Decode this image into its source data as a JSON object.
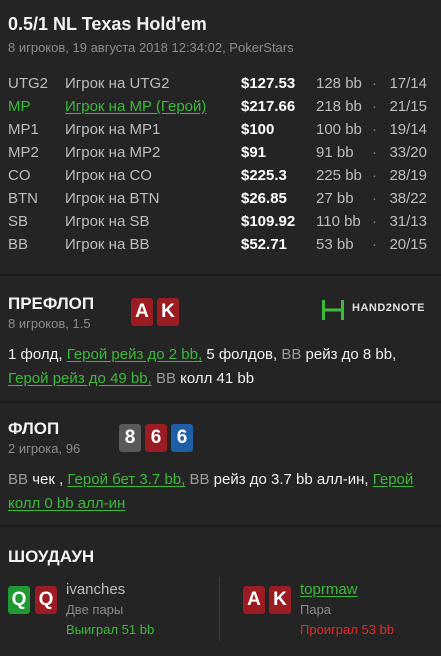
{
  "header": {
    "title": "0.5/1 NL Texas Hold'em",
    "subtitle": "8 игроков, 19 августа 2018 12:34:02, PokerStars"
  },
  "players": [
    {
      "pos": "UTG2",
      "name": "Игрок на UTG2",
      "stack": "$127.53",
      "bb": "128 bb",
      "dot": "·",
      "ratio": "17/14"
    },
    {
      "pos": "MP",
      "name": "Игрок на MP (Герой)",
      "stack": "$217.66",
      "bb": "218 bb",
      "dot": "·",
      "ratio": "21/15"
    },
    {
      "pos": "MP1",
      "name": "Игрок на MP1",
      "stack": "$100",
      "bb": "100 bb",
      "dot": "·",
      "ratio": "19/14"
    },
    {
      "pos": "MP2",
      "name": "Игрок на MP2",
      "stack": "$91",
      "bb": "91 bb",
      "dot": "·",
      "ratio": "33/20"
    },
    {
      "pos": "CO",
      "name": "Игрок на CO",
      "stack": "$225.3",
      "bb": "225 bb",
      "dot": "·",
      "ratio": "28/19"
    },
    {
      "pos": "BTN",
      "name": "Игрок на BTN",
      "stack": "$26.85",
      "bb": "27 bb",
      "dot": "·",
      "ratio": "38/22"
    },
    {
      "pos": "SB",
      "name": "Игрок на SB",
      "stack": "$109.92",
      "bb": "110 bb",
      "dot": "·",
      "ratio": "31/13"
    },
    {
      "pos": "BB",
      "name": "Игрок на BB",
      "stack": "$52.71",
      "bb": "53 bb",
      "dot": "·",
      "ratio": "20/15"
    }
  ],
  "preflop": {
    "title": "ПРЕФЛОП",
    "sub": "8 игроков, 1.5",
    "cards": [
      {
        "rank": "A",
        "color": "#9b1c22"
      },
      {
        "rank": "K",
        "color": "#9b1c22"
      }
    ],
    "logo_text": "HAND2NOTE",
    "logo_icon": "hand2note-logo-icon",
    "actions": {
      "a1": "1 фолд,",
      "a2": "Герой рейз до 2 bb,",
      "a3": "5 фолдов,",
      "a4": "BB",
      "a5": "рейз до 8 bb,",
      "a6": "Герой рейз до 49 bb,",
      "a7": "BB",
      "a8": "колл 41 bb"
    }
  },
  "flop": {
    "title": "ФЛОП",
    "sub": "2 игрока, 96",
    "cards": [
      {
        "rank": "8",
        "color": "#5a5a5a"
      },
      {
        "rank": "6",
        "color": "#9b1c22"
      },
      {
        "rank": "6",
        "color": "#1f5fa8"
      }
    ],
    "actions": {
      "a1": "BB",
      "a2": "чек ,",
      "a3": "Герой бет 3.7 bb,",
      "a4": "BB",
      "a5": "рейз до 3.7 bb алл-ин,",
      "a6": "Герой колл 0 bb алл-ин"
    }
  },
  "showdown": {
    "title": "ШОУДАУН",
    "left": {
      "cards": [
        {
          "rank": "Q",
          "color": "#1f9a33"
        },
        {
          "rank": "Q",
          "color": "#9b1c22"
        }
      ],
      "name": "ivanches",
      "hand": "Две пары",
      "result": "Выиграл 51 bb"
    },
    "right": {
      "cards": [
        {
          "rank": "A",
          "color": "#9b1c22"
        },
        {
          "rank": "K",
          "color": "#9b1c22"
        }
      ],
      "name": "toprmaw",
      "hand": "Пара",
      "result": "Проиграл 53 bb"
    }
  }
}
